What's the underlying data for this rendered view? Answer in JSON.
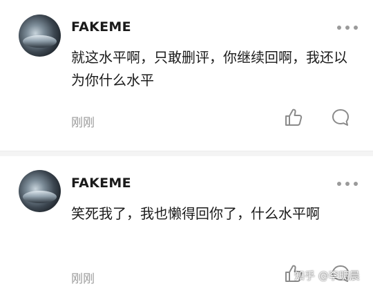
{
  "comments": [
    {
      "username": "FAKEME",
      "text": "就这水平啊，只敢删评，你继续回啊，我还以为你什么水平",
      "time": "刚刚",
      "like_icon": "thumbs-up-icon",
      "reply_icon": "chat-bubble-icon",
      "more_icon": "more-dots-icon"
    },
    {
      "username": "FAKEME",
      "text": "笑死我了，我也懒得回你了，什么水平啊",
      "time": "刚刚",
      "like_icon": "thumbs-up-icon",
      "reply_icon": "chat-bubble-icon",
      "more_icon": "more-dots-icon"
    }
  ],
  "watermark": "知乎 @李明晨",
  "colors": {
    "text": "#1a1a1a",
    "muted": "#9a9a9a",
    "divider": "#f4f4f4"
  }
}
